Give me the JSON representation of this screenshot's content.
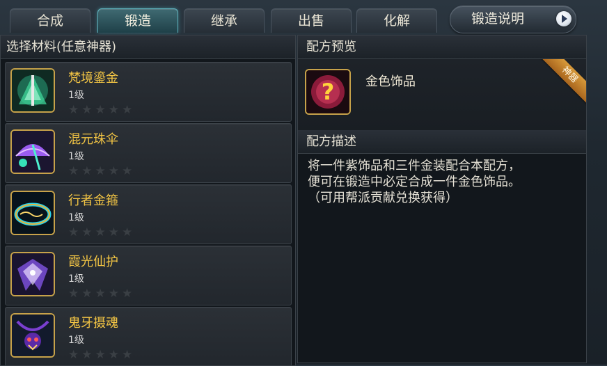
{
  "tabs": [
    {
      "label": "合成"
    },
    {
      "label": "锻造"
    },
    {
      "label": "继承"
    },
    {
      "label": "出售"
    },
    {
      "label": "化解"
    }
  ],
  "active_tab": "锻造",
  "help_button": {
    "label": "锻造说明"
  },
  "left_panel": {
    "title": "选择材料(任意神器)",
    "items": [
      {
        "name": "梵境鎏金",
        "level": "1级",
        "stars": "★★★★★",
        "icon": "green-crystal-staff-icon"
      },
      {
        "name": "混元珠伞",
        "level": "1级",
        "stars": "★★★★★",
        "icon": "purple-umbrella-icon"
      },
      {
        "name": "行者金箍",
        "level": "1级",
        "stars": "★★★★★",
        "icon": "golden-ring-icon"
      },
      {
        "name": "霞光仙护",
        "level": "1级",
        "stars": "★★★★★",
        "icon": "violet-wing-icon"
      },
      {
        "name": "鬼牙摄魂",
        "level": "1级",
        "stars": "★★★★★",
        "icon": "demon-amulet-icon"
      }
    ]
  },
  "right_panel": {
    "preview_title": "配方预览",
    "preview_item": {
      "name": "金色饰品",
      "icon": "question-mark-icon",
      "badge": "神器"
    },
    "desc_title": "配方描述",
    "description": [
      "将一件紫饰品和三件金装配合本配方，",
      "便可在锻造中必定合成一件金色饰品。",
      "（可用帮派贡献兑换获得）"
    ]
  },
  "colors": {
    "item_name": "#f3c544",
    "active_tab": "#5fb2bd",
    "frame_gold": "#c7a24a",
    "badge": "#d89a3a"
  }
}
